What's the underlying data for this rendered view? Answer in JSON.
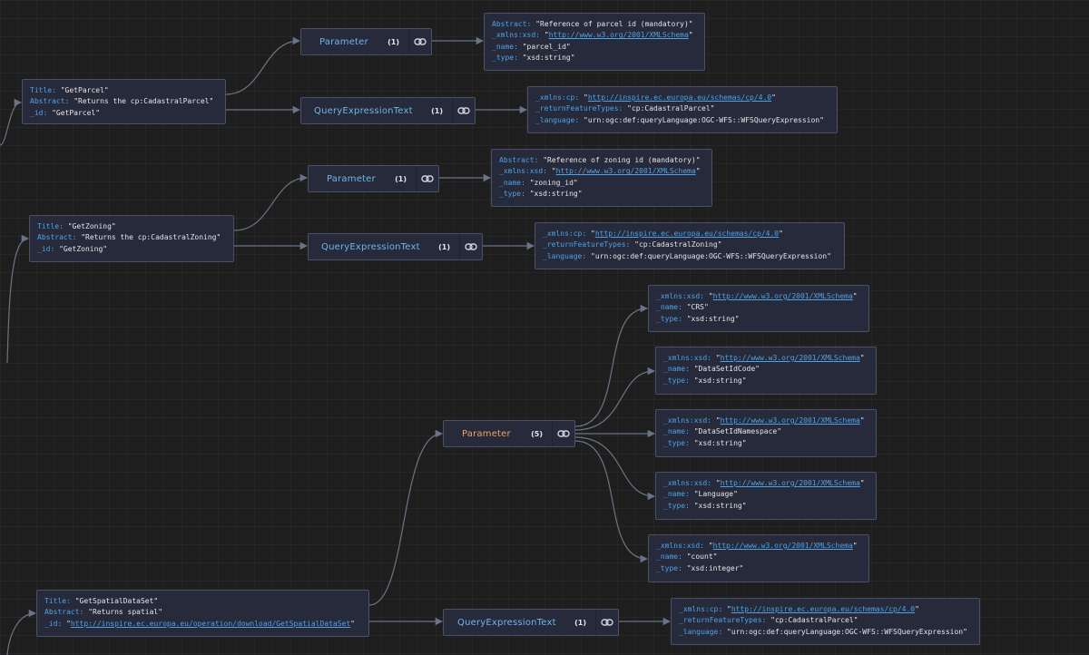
{
  "colors": {
    "key": "#4ea3e6",
    "value": "#e6e6e6",
    "link": "#4ea3e6",
    "node_label": "#6fb6ec",
    "node_label_highlight": "#f0a35e",
    "edge": "#6b7486",
    "card_bg": "#262a3b"
  },
  "cards": {
    "getparcel": [
      {
        "k": "Title:",
        "v": "\"GetParcel\""
      },
      {
        "k": "Abstract:",
        "v": "\"Returns the cp:CadastralParcel\""
      },
      {
        "k": "_id:",
        "v": "\"GetParcel\""
      }
    ],
    "getparcel_param": [
      {
        "k": "Abstract:",
        "v": "\"Reference of parcel id (mandatory)\""
      },
      {
        "k": "_xmlns:xsd:",
        "link": "http://www.w3.org/2001/XMLSchema"
      },
      {
        "k": "_name:",
        "v": "\"parcel_id\""
      },
      {
        "k": "_type:",
        "v": "\"xsd:string\""
      }
    ],
    "getparcel_qet": [
      {
        "k": "_xmlns:cp:",
        "link": "http://inspire.ec.europa.eu/schemas/cp/4.0"
      },
      {
        "k": "_returnFeatureTypes:",
        "v": "\"cp:CadastralParcel\""
      },
      {
        "k": "_language:",
        "v": "\"urn:ogc:def:queryLanguage:OGC-WFS::WFSQueryExpression\""
      }
    ],
    "getzoning": [
      {
        "k": "Title:",
        "v": "\"GetZoning\""
      },
      {
        "k": "Abstract:",
        "v": "\"Returns the cp:CadastralZoning\""
      },
      {
        "k": "_id:",
        "v": "\"GetZoning\""
      }
    ],
    "getzoning_param": [
      {
        "k": "Abstract:",
        "v": "\"Reference of zoning id (mandatory)\""
      },
      {
        "k": "_xmlns:xsd:",
        "link": "http://www.w3.org/2001/XMLSchema"
      },
      {
        "k": "_name:",
        "v": "\"zoning_id\""
      },
      {
        "k": "_type:",
        "v": "\"xsd:string\""
      }
    ],
    "getzoning_qet": [
      {
        "k": "_xmlns:cp:",
        "link": "http://inspire.ec.europa.eu/schemas/cp/4.0"
      },
      {
        "k": "_returnFeatureTypes:",
        "v": "\"cp:CadastralZoning\""
      },
      {
        "k": "_language:",
        "v": "\"urn:ogc:def:queryLanguage:OGC-WFS::WFSQueryExpression\""
      }
    ],
    "p_crs": [
      {
        "k": "_xmlns:xsd:",
        "link": "http://www.w3.org/2001/XMLSchema"
      },
      {
        "k": "_name:",
        "v": "\"CRS\""
      },
      {
        "k": "_type:",
        "v": "\"xsd:string\""
      }
    ],
    "p_dsidcode": [
      {
        "k": "_xmlns:xsd:",
        "link": "http://www.w3.org/2001/XMLSchema"
      },
      {
        "k": "_name:",
        "v": "\"DataSetIdCode\""
      },
      {
        "k": "_type:",
        "v": "\"xsd:string\""
      }
    ],
    "p_dsidns": [
      {
        "k": "_xmlns:xsd:",
        "link": "http://www.w3.org/2001/XMLSchema"
      },
      {
        "k": "_name:",
        "v": "\"DataSetIdNamespace\""
      },
      {
        "k": "_type:",
        "v": "\"xsd:string\""
      }
    ],
    "p_language": [
      {
        "k": "_xmlns:xsd:",
        "link": "http://www.w3.org/2001/XMLSchema"
      },
      {
        "k": "_name:",
        "v": "\"Language\""
      },
      {
        "k": "_type:",
        "v": "\"xsd:string\""
      }
    ],
    "p_count": [
      {
        "k": "_xmlns:xsd:",
        "link": "http://www.w3.org/2001/XMLSchema"
      },
      {
        "k": "_name:",
        "v": "\"count\""
      },
      {
        "k": "_type:",
        "v": "\"xsd:integer\""
      }
    ],
    "getspatial": [
      {
        "k": "Title:",
        "v": "\"GetSpatialDataSet\""
      },
      {
        "k": "Abstract:",
        "v": "\"Returns spatial\""
      },
      {
        "k": "_id:",
        "link": "http://inspire.ec.europa.eu/operation/download/GetSpatialDataSet"
      }
    ],
    "getspatial_qet": [
      {
        "k": "_xmlns:cp:",
        "link": "http://inspire.ec.europa.eu/schemas/cp/4.0"
      },
      {
        "k": "_returnFeatureTypes:",
        "v": "\"cp:CadastralParcel\""
      },
      {
        "k": "_language:",
        "v": "\"urn:ogc:def:queryLanguage:OGC-WFS::WFSQueryExpression\""
      }
    ]
  },
  "nodes": {
    "getparcel_param": {
      "label": "Parameter",
      "count": "(1)",
      "icon": "link-icon"
    },
    "getparcel_qet": {
      "label": "QueryExpressionText",
      "count": "(1)",
      "icon": "link-icon"
    },
    "getzoning_param": {
      "label": "Parameter",
      "count": "(1)",
      "icon": "link-icon"
    },
    "getzoning_qet": {
      "label": "QueryExpressionText",
      "count": "(1)",
      "icon": "link-icon"
    },
    "getspatial_param": {
      "label": "Parameter",
      "count": "(5)",
      "icon": "link-icon"
    },
    "getspatial_qet": {
      "label": "QueryExpressionText",
      "count": "(1)",
      "icon": "link-icon"
    }
  }
}
